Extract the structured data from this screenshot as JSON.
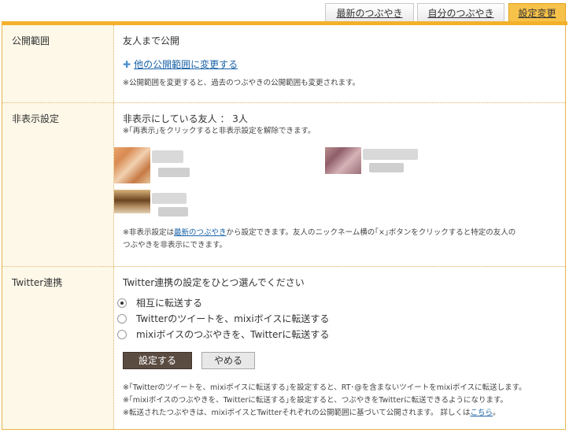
{
  "tabs": [
    {
      "label": "最新のつぶやき"
    },
    {
      "label": "自分のつぶやき"
    },
    {
      "label": "設定変更"
    }
  ],
  "visibility": {
    "label": "公開範囲",
    "value": "友人まで公開",
    "change_link": "他の公開範囲に変更する",
    "note": "※公開範囲を変更すると、過去のつぶやきの公開範囲も変更されます。"
  },
  "hidden": {
    "label": "非表示設定",
    "count_text": "非表示にしている友人 ： 3人",
    "hint": "※｢再表示｣をクリックすると非表示設定を解除できます。",
    "note_prefix": "※非表示設定は",
    "note_link": "最新のつぶやき",
    "note_suffix_1": "から設定できます。友人のニックネーム横の｢×｣ボタンをクリックすると特定の友人の",
    "note_suffix_2": "つぶやきを非表示にできます。"
  },
  "twitter": {
    "label": "Twitter連携",
    "prompt": "Twitter連携の設定をひとつ選んでください",
    "options": [
      {
        "label": "相互に転送する",
        "selected": true
      },
      {
        "label": "Twitterのツイートを、mixiボイスに転送する",
        "selected": false
      },
      {
        "label": "mixiボイスのつぶやきを、Twitterに転送する",
        "selected": false
      }
    ],
    "save_label": "設定する",
    "cancel_label": "やめる",
    "notes": [
      "※｢Twitterのツイートを、mixiボイスに転送する｣を設定すると、RT･@を含まないツイートをmixiボイスに転送します。",
      "※｢mixiボイスのつぶやきを、Twitterに転送する｣を設定すると、つぶやきをTwitterに転送できるようになります。",
      "※転送されたつぶやきは、mixiボイスとTwitterそれぞれの公開範囲に基づいて公開されます。 詳しくは"
    ],
    "details_link": "こちら",
    "details_end": "。"
  },
  "colors": {
    "accent": "#f3b12b",
    "label_bg": "#fdf8e8",
    "link": "#1b63a8",
    "save_bg": "#5b4c42"
  }
}
